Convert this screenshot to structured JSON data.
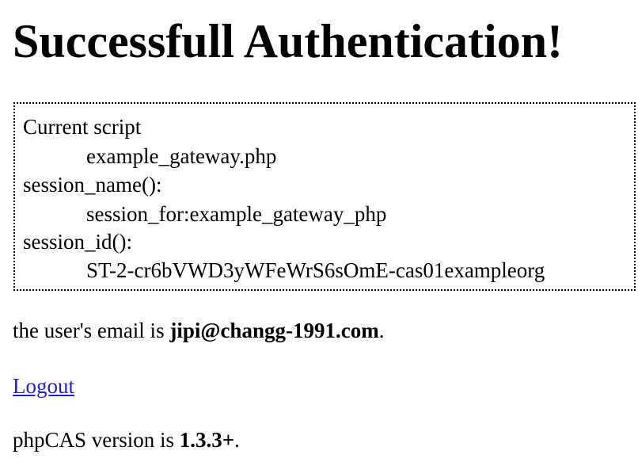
{
  "page": {
    "heading": "Successfull Authentication!"
  },
  "info": {
    "current_script_label": "Current script",
    "current_script_value": "example_gateway.php",
    "session_name_label": "session_name():",
    "session_name_value": "session_for:example_gateway_php",
    "session_id_label": "session_id():",
    "session_id_value": "ST-2-cr6bVWD3yWFeWrS6sOmE-cas01exampleorg"
  },
  "email": {
    "prefix": "the user's email is ",
    "value": "jipi@changg-1991.com",
    "suffix": "."
  },
  "logout": {
    "label": "Logout"
  },
  "version": {
    "prefix": "phpCAS version is ",
    "value": "1.3.3+",
    "suffix": "."
  },
  "colors": {
    "link": "#2222cc",
    "text": "#000000",
    "background": "#ffffff"
  }
}
